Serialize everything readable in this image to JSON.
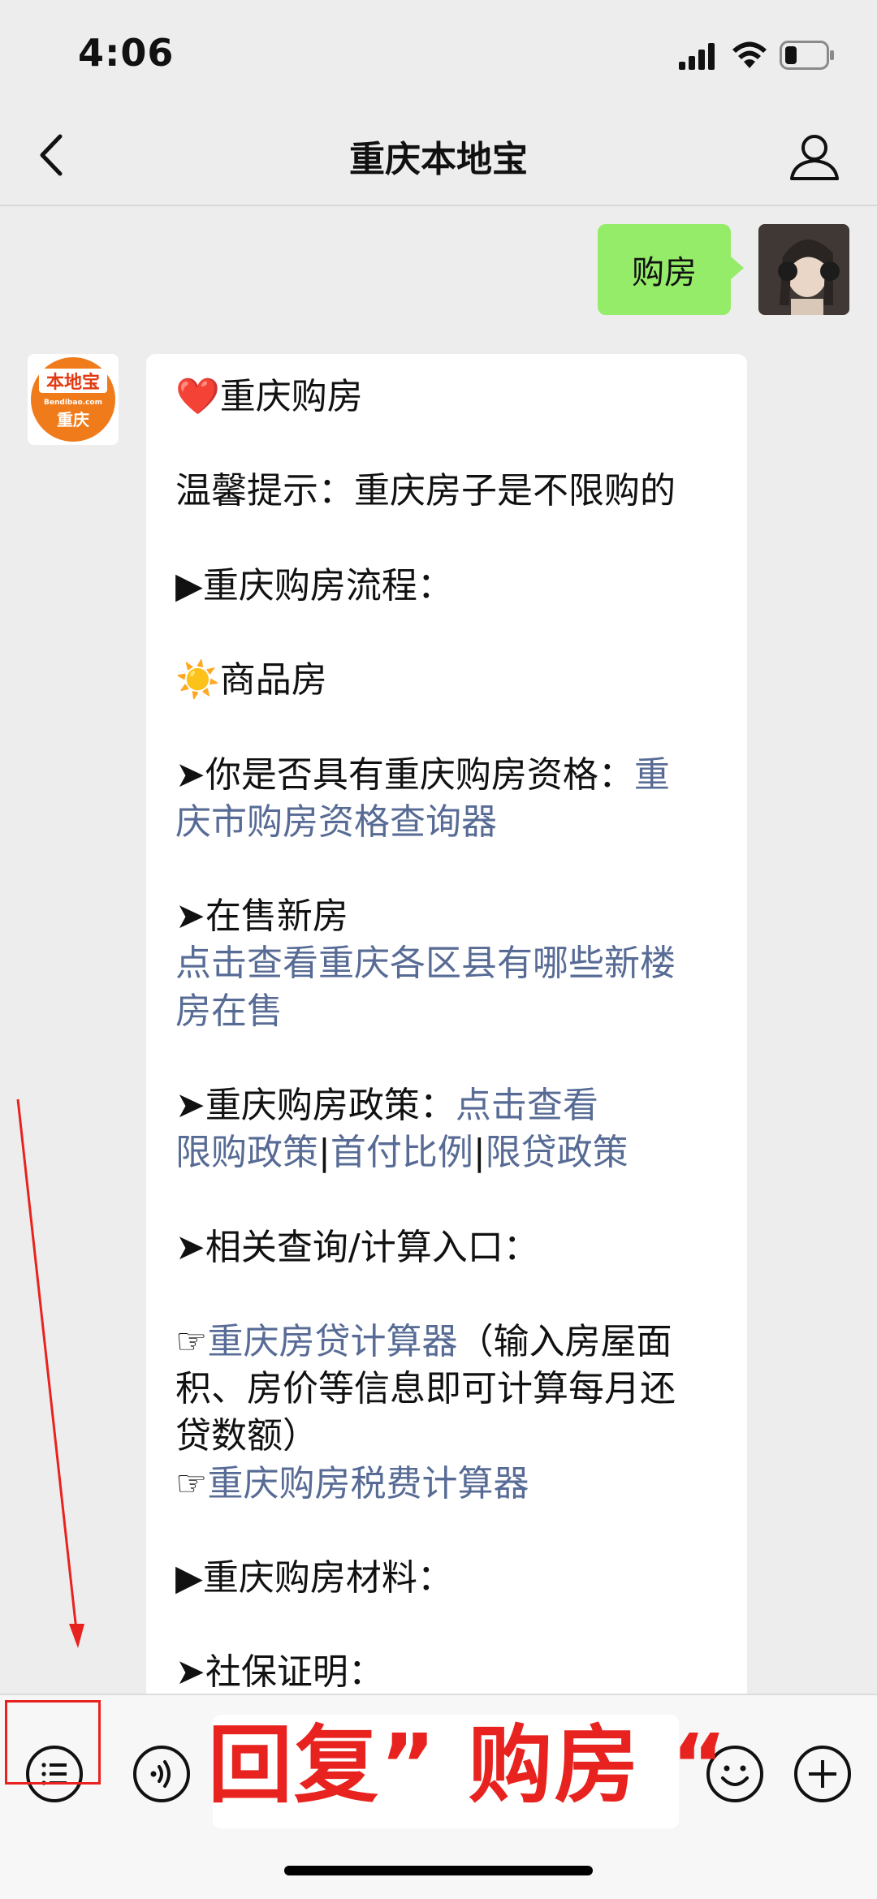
{
  "status_bar": {
    "time": "4:06",
    "icons": [
      "signal-icon",
      "wifi-icon",
      "battery-icon"
    ]
  },
  "nav": {
    "title": "重庆本地宝",
    "back_icon": "back-icon",
    "profile_icon": "profile-icon"
  },
  "outgoing_message": {
    "text": "购房"
  },
  "bot_avatar": {
    "top_text": "本地宝",
    "sub_text": "Bendibao.com",
    "city_text": "重庆"
  },
  "incoming_message": {
    "heading_emoji": "❤️",
    "heading": "重庆购房",
    "tip": "温馨提示：重庆房子是不限购的",
    "process_title": "▶重庆购房流程：",
    "sun_emoji": "☀️",
    "commodity_housing": "商品房",
    "qualification_prefix": "➤你是否具有重庆购房资格：",
    "qualification_link_part1": "重",
    "qualification_link_part2": "庆市购房资格查询器",
    "new_homes_title": "➤在售新房",
    "new_homes_link_line1": "点击查看重庆各区县有哪些新楼",
    "new_homes_link_line2": "房在售",
    "policy_prefix": "➤重庆购房政策：",
    "policy_link": "点击查看",
    "policy_link_limit": "限购政策",
    "separator": "|",
    "policy_link_down_payment": "首付比例",
    "policy_link_loan": "限贷政策",
    "query_title": "➤相关查询/计算入口：",
    "hand_emoji": "☞",
    "loan_calc_link": "重庆房贷计算器",
    "loan_calc_desc_line1": "（输入房屋面",
    "loan_calc_desc_line2": "积、房价等信息即可计算每月还",
    "loan_calc_desc_line3": "贷数额）",
    "tax_calc_link": "重庆购房税费计算器",
    "materials_title": "▶重庆购房材料：",
    "social_security_title": "➤社保证明："
  },
  "bottom_bar": {
    "icons": [
      "menu-icon",
      "voice-icon",
      "emoji-icon",
      "plus-icon"
    ],
    "annotation": "回复”  购房  “"
  },
  "colors": {
    "bubble_out": "#95ec69",
    "link": "#576b95",
    "annotation": "#e8231f",
    "background": "#ededed"
  }
}
